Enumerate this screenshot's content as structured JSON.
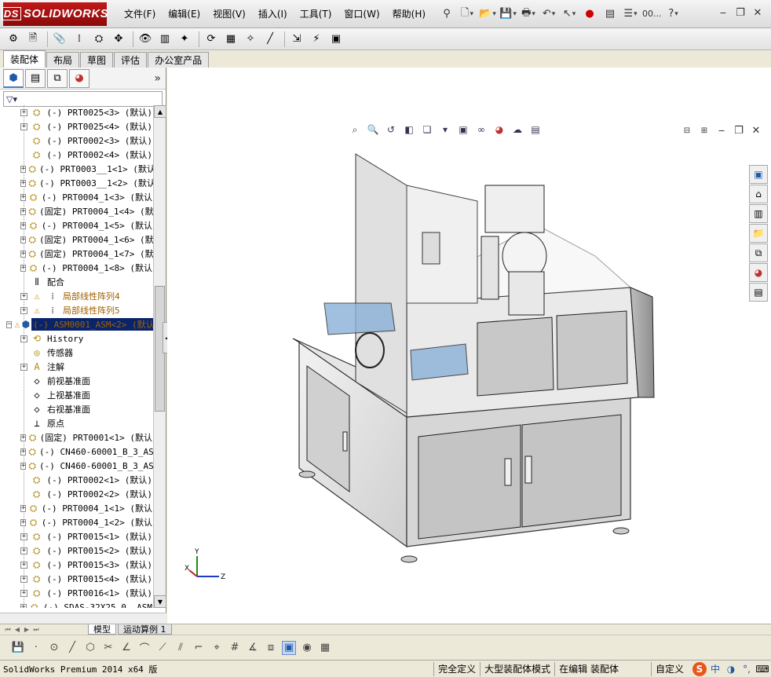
{
  "app": {
    "logo_text": "SOLIDWORKS",
    "logo_ds": "DS"
  },
  "menus": [
    "文件(F)",
    "编辑(E)",
    "视图(V)",
    "插入(I)",
    "工具(T)",
    "窗口(W)",
    "帮助(H)"
  ],
  "title_tools": {
    "more_label": "00..."
  },
  "command_tabs": [
    {
      "label": "装配体",
      "active": true
    },
    {
      "label": "布局",
      "active": false
    },
    {
      "label": "草图",
      "active": false
    },
    {
      "label": "评估",
      "active": false
    },
    {
      "label": "办公室产品",
      "active": false
    }
  ],
  "feature_manager": {
    "tabs": [
      "feature-manager-icon",
      "property-manager-icon",
      "configuration-manager-icon",
      "appearance-manager-icon"
    ],
    "more": "»",
    "filter": "▽▾",
    "tree": [
      {
        "label": "(-) PRT0025<3> (默认)",
        "icon": "part",
        "expand": "+",
        "warn": false,
        "selected": false
      },
      {
        "label": "(-) PRT0025<4> (默认)",
        "icon": "part",
        "expand": "+",
        "warn": false,
        "selected": false
      },
      {
        "label": "(-) PRT0002<3> (默认)",
        "icon": "part",
        "expand": "",
        "warn": false,
        "selected": false
      },
      {
        "label": "(-) PRT0002<4> (默认)",
        "icon": "part",
        "expand": "",
        "warn": false,
        "selected": false
      },
      {
        "label": "(-) PRT0003__1<1> (默认",
        "icon": "part",
        "expand": "+",
        "warn": false,
        "selected": false
      },
      {
        "label": "(-) PRT0003__1<2> (默认",
        "icon": "part",
        "expand": "+",
        "warn": false,
        "selected": false
      },
      {
        "label": "(-) PRT0004_1<3> (默认",
        "icon": "part",
        "expand": "+",
        "warn": false,
        "selected": false
      },
      {
        "label": "(固定) PRT0004_1<4> (默",
        "icon": "part",
        "expand": "+",
        "warn": false,
        "selected": false
      },
      {
        "label": "(-) PRT0004_1<5> (默认",
        "icon": "part",
        "expand": "+",
        "warn": false,
        "selected": false
      },
      {
        "label": "(固定) PRT0004_1<6> (默",
        "icon": "part",
        "expand": "+",
        "warn": false,
        "selected": false
      },
      {
        "label": "(固定) PRT0004_1<7> (默",
        "icon": "part",
        "expand": "+",
        "warn": false,
        "selected": false
      },
      {
        "label": "(-) PRT0004_1<8> (默认",
        "icon": "part",
        "expand": "+",
        "warn": false,
        "selected": false
      },
      {
        "label": "配合",
        "icon": "mates",
        "expand": "",
        "warn": false,
        "selected": false
      },
      {
        "label": "局部线性阵列4",
        "icon": "pattern",
        "expand": "+",
        "warn": true,
        "selected": false
      },
      {
        "label": "局部线性阵列5",
        "icon": "pattern",
        "expand": "+",
        "warn": true,
        "selected": false
      },
      {
        "label": "(-) ASM0001_ASM<2> (默认",
        "icon": "assembly",
        "expand": "−",
        "warn": true,
        "selected": true,
        "level": 0
      },
      {
        "label": "History",
        "icon": "history",
        "expand": "+",
        "warn": false,
        "selected": false
      },
      {
        "label": "传感器",
        "icon": "sensor",
        "expand": "",
        "warn": false,
        "selected": false
      },
      {
        "label": "注解",
        "icon": "annotation",
        "expand": "+",
        "warn": false,
        "selected": false
      },
      {
        "label": "前视基准面",
        "icon": "plane",
        "expand": "",
        "warn": false,
        "selected": false
      },
      {
        "label": "上视基准面",
        "icon": "plane",
        "expand": "",
        "warn": false,
        "selected": false
      },
      {
        "label": "右视基准面",
        "icon": "plane",
        "expand": "",
        "warn": false,
        "selected": false
      },
      {
        "label": "原点",
        "icon": "origin",
        "expand": "",
        "warn": false,
        "selected": false
      },
      {
        "label": "(固定) PRT0001<1> (默认",
        "icon": "part",
        "expand": "+",
        "warn": false,
        "selected": false
      },
      {
        "label": "(-) CN460-60001_B_3_AS",
        "icon": "part",
        "expand": "+",
        "warn": false,
        "selected": false
      },
      {
        "label": "(-) CN460-60001_B_3_AS",
        "icon": "part",
        "expand": "+",
        "warn": false,
        "selected": false
      },
      {
        "label": "(-) PRT0002<1> (默认)",
        "icon": "part",
        "expand": "",
        "warn": false,
        "selected": false
      },
      {
        "label": "(-) PRT0002<2> (默认)",
        "icon": "part",
        "expand": "",
        "warn": false,
        "selected": false
      },
      {
        "label": "(-) PRT0004_1<1> (默认",
        "icon": "part",
        "expand": "+",
        "warn": false,
        "selected": false
      },
      {
        "label": "(-) PRT0004_1<2> (默认",
        "icon": "part",
        "expand": "+",
        "warn": false,
        "selected": false
      },
      {
        "label": "(-) PRT0015<1> (默认)",
        "icon": "part",
        "expand": "+",
        "warn": false,
        "selected": false
      },
      {
        "label": "(-) PRT0015<2> (默认)",
        "icon": "part",
        "expand": "+",
        "warn": false,
        "selected": false
      },
      {
        "label": "(-) PRT0015<3> (默认)",
        "icon": "part",
        "expand": "+",
        "warn": false,
        "selected": false
      },
      {
        "label": "(-) PRT0015<4> (默认)",
        "icon": "part",
        "expand": "+",
        "warn": false,
        "selected": false
      },
      {
        "label": "(-) PRT0016<1> (默认)",
        "icon": "part",
        "expand": "+",
        "warn": false,
        "selected": false
      },
      {
        "label": "(-) SDAS-32X25_0__ASM",
        "icon": "part",
        "expand": "+",
        "warn": false,
        "selected": false
      }
    ]
  },
  "bottom_tabs": [
    {
      "label": "模型",
      "active": true
    },
    {
      "label": "运动算例 1",
      "active": false
    }
  ],
  "triad": {
    "x": "X",
    "y": "Y",
    "z": "Z"
  },
  "status": {
    "version": "SolidWorks Premium 2014 x64 版",
    "fields": [
      "完全定义",
      "大型装配体模式",
      "在编辑 装配体"
    ],
    "custom": "自定义",
    "ime_s": "S",
    "ime_lang": "中"
  },
  "colors": {
    "selection": "#0a246a",
    "warning": "#a06000",
    "logo_red": "#c01818"
  }
}
